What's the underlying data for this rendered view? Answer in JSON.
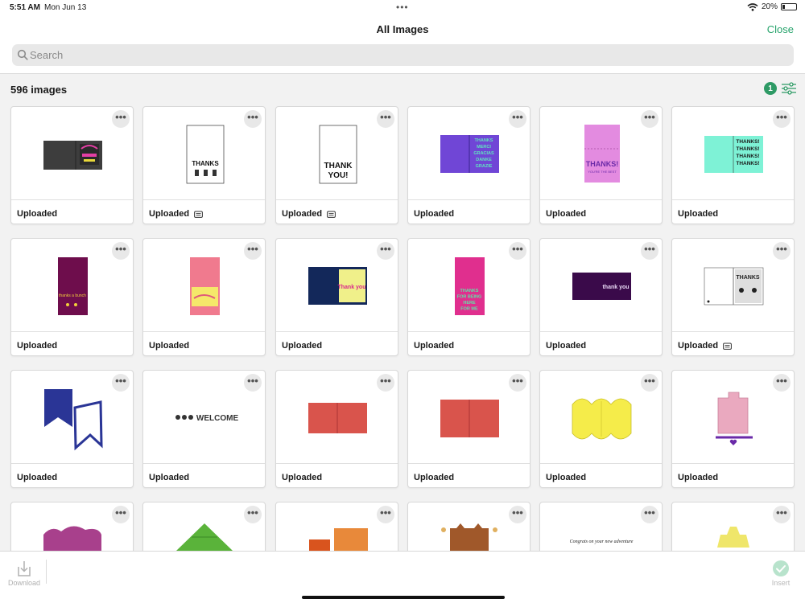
{
  "status": {
    "time": "5:51 AM",
    "date": "Mon Jun 13",
    "battery": "20%",
    "battery_level": 0.2
  },
  "nav": {
    "title": "All Images",
    "close_label": "Close"
  },
  "search": {
    "placeholder": "Search",
    "value": ""
  },
  "count_label": "596 images",
  "filter": {
    "badge": "1"
  },
  "toolbar": {
    "download_label": "Download",
    "insert_label": "Insert"
  },
  "colors": {
    "accent": "#26a36b",
    "badge": "#2e9a65"
  },
  "cards": [
    {
      "label": "Uploaded",
      "subscription": false
    },
    {
      "label": "Uploaded",
      "subscription": true
    },
    {
      "label": "Uploaded",
      "subscription": true
    },
    {
      "label": "Uploaded",
      "subscription": false
    },
    {
      "label": "Uploaded",
      "subscription": false
    },
    {
      "label": "Uploaded",
      "subscription": false
    },
    {
      "label": "Uploaded",
      "subscription": false
    },
    {
      "label": "Uploaded",
      "subscription": false
    },
    {
      "label": "Uploaded",
      "subscription": false
    },
    {
      "label": "Uploaded",
      "subscription": false
    },
    {
      "label": "Uploaded",
      "subscription": false
    },
    {
      "label": "Uploaded",
      "subscription": true
    },
    {
      "label": "Uploaded",
      "subscription": false
    },
    {
      "label": "Uploaded",
      "subscription": false
    },
    {
      "label": "Uploaded",
      "subscription": false
    },
    {
      "label": "Uploaded",
      "subscription": false
    },
    {
      "label": "Uploaded",
      "subscription": false
    },
    {
      "label": "Uploaded",
      "subscription": false
    },
    {
      "label": "",
      "subscription": false
    },
    {
      "label": "",
      "subscription": false
    },
    {
      "label": "",
      "subscription": false
    },
    {
      "label": "",
      "subscription": false
    },
    {
      "label": "",
      "subscription": false
    },
    {
      "label": "",
      "subscription": false
    }
  ],
  "thumb_text": {
    "c2": "THANKS",
    "c3a": "THANK",
    "c3b": "YOU!",
    "c4": [
      "THANKS",
      "MERCI",
      "GRACIAS",
      "DANKE",
      "GRAZIE"
    ],
    "c5a": "THANKS!",
    "c5b": "YOU'RE THE BEST",
    "c6": [
      "THANKS!",
      "THANKS!",
      "THANKS!",
      "THANKS!"
    ],
    "c7": "thanks a bunch",
    "c9": "Thank you",
    "c10": [
      "THANKS",
      "FOR BEING",
      "HERE",
      "FOR ME"
    ],
    "c11": "thank you",
    "c12": "THANKS",
    "c14": "WELCOME",
    "c23": "Congrats on your new adventure"
  }
}
